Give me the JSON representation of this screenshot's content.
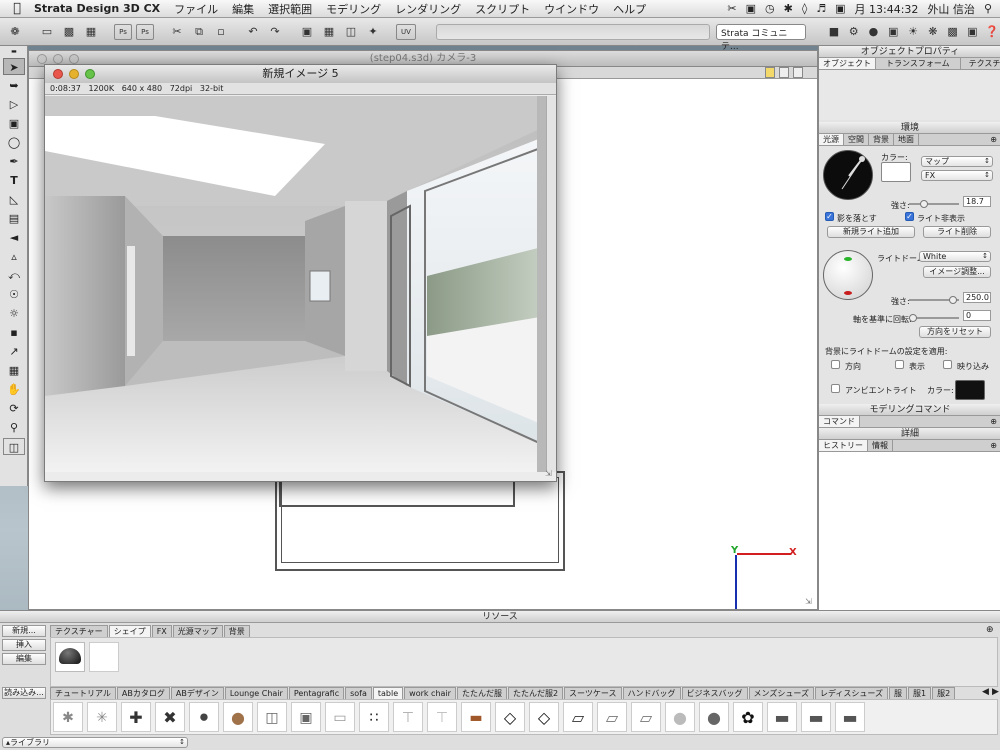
{
  "menubar": {
    "app": "Strata Design 3D CX",
    "menus": [
      "ファイル",
      "編集",
      "選択範囲",
      "モデリング",
      "レンダリング",
      "スクリプト",
      "ウインドウ",
      "ヘルプ"
    ],
    "clock": "月 13:44:32",
    "user": "外山 信治"
  },
  "toolbar": {
    "camera_dropdown": "Strata コミュニテ..."
  },
  "model_window": {
    "title": "(step04.s3d) カメラ-3"
  },
  "render_window": {
    "title": "新規イメージ 5",
    "info": "0:08:37   1200K   640 x 480   72dpi   32-bit"
  },
  "object_props": {
    "title": "オブジェクトプロパティ",
    "tabs": [
      "オブジェクト",
      "トランスフォーム",
      "テクスチャー"
    ]
  },
  "environment": {
    "title": "環境",
    "tabs": [
      "光源",
      "空間",
      "背景",
      "地面"
    ],
    "color_label": "カラー:",
    "map_dropdown": "マップ",
    "fx_dropdown": "FX",
    "strength_label": "強さ:",
    "strength_value": "18.7",
    "strength_fraction": 0.25,
    "shadow_label": "影を落とす",
    "hide_light_label": "ライト非表示",
    "add_light": "新規ライト追加",
    "delete_light": "ライト削除",
    "dome_label": "ライトドーム:",
    "dome_value": "White",
    "image_adjust": "イメージ調整...",
    "strength2_label": "強さ:",
    "strength2_value": "250.0",
    "strength2_fraction": 0.95,
    "rotate_label": "軸を基準に回転:",
    "rotate_value": "0",
    "rotate_fraction": 0.0,
    "reset_dir": "方向をリセット",
    "apply_label": "背景にライトドームの設定を適用:",
    "apply_opts": [
      "方向",
      "表示",
      "映り込み"
    ],
    "ambient_label": "アンビエントライト",
    "ambient_color_label": "カラー:"
  },
  "modeling_cmd": {
    "title": "モデリングコマンド",
    "tab": "コマンド"
  },
  "detail": {
    "title": "詳細",
    "tabs": [
      "ヒストリー",
      "情報"
    ]
  },
  "resources": {
    "title": "リソース",
    "side_buttons": [
      "新規...",
      "挿入",
      "編集"
    ],
    "load_button": "読み込み...",
    "tabs": [
      "テクスチャー",
      "シェイプ",
      "FX",
      "光源マップ",
      "背景"
    ],
    "active_tab": 1,
    "lib_tabs": [
      "チュートリアル",
      "ABカタログ",
      "ABデザイン",
      "Lounge Chair",
      "Pentagrafic",
      "sofa",
      "table",
      "work chair",
      "たたんだ服",
      "たたんだ服2",
      "スーツケース",
      "ハンドバッグ",
      "ビジネスバッグ",
      "メンズシューズ",
      "レディスシューズ",
      "服",
      "服1",
      "服2"
    ],
    "active_lib": 6,
    "library_dropdown": "▴ライブラリ"
  },
  "axes": {
    "y": "Y",
    "x": "X"
  },
  "colors": {
    "accent": "#3a74d8",
    "axis_x": "#d21e1e",
    "axis_y": "#1fa52a",
    "axis_z": "#1a2fb0"
  }
}
